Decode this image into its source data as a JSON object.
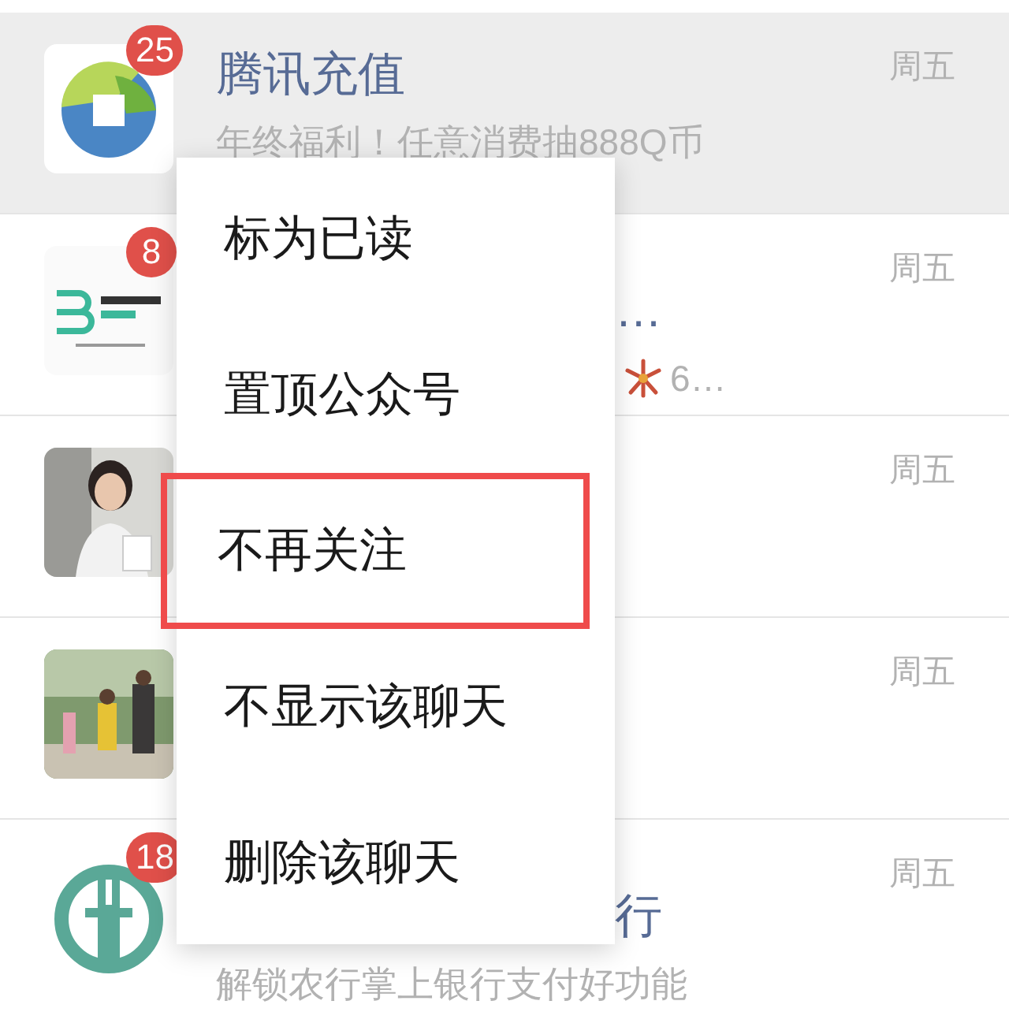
{
  "chats": [
    {
      "avatar": {
        "kind": "ball"
      },
      "badge": "25",
      "title": "腾讯充值",
      "subtitle": "年终福利！任意消费抽888Q币",
      "time": "周五",
      "kind": "clear",
      "selected": true
    },
    {
      "avatar": {
        "kind": "logo"
      },
      "badge": "8",
      "title": "…",
      "subtitle": "6…",
      "subtitle_icon": {
        "kind": "firework"
      },
      "time": "周五",
      "kind": "covered",
      "selected": false
    },
    {
      "time": "周五",
      "kind": "covered",
      "selected": false
    },
    {
      "avatar": {
        "kind": "photo_outdoor"
      },
      "time": "周五",
      "kind": "covered",
      "selected": false
    },
    {
      "avatar": {
        "kind": "bank"
      },
      "badge": "18",
      "title": "行",
      "subtitle": "解锁农行掌上银行支付好功能",
      "time": "周五",
      "kind": "title_covered",
      "selected": false
    }
  ],
  "menu": [
    {
      "label": "标为已读",
      "highlighted": false
    },
    {
      "label": "置顶公众号",
      "highlighted": false
    },
    {
      "label": "不再关注",
      "highlighted": true
    },
    {
      "label": "不显示该聊天",
      "highlighted": false
    },
    {
      "label": "删除该聊天",
      "highlighted": false
    }
  ]
}
